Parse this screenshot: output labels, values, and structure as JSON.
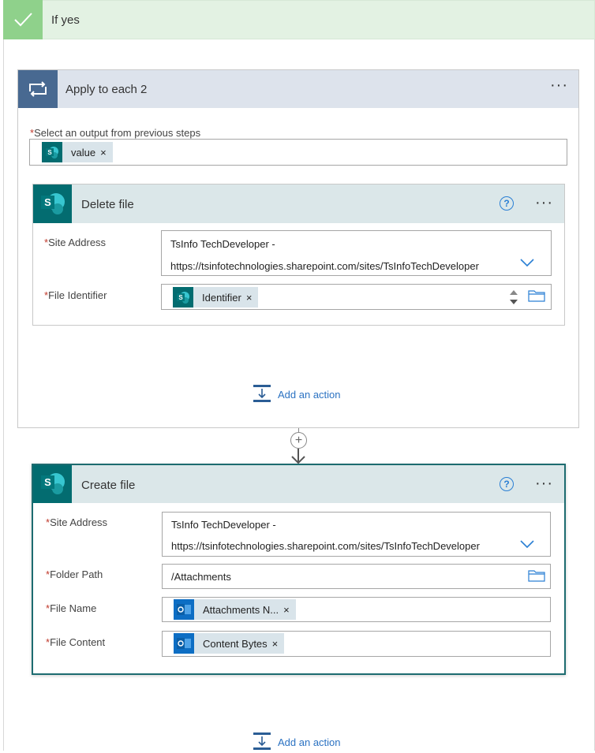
{
  "if_yes": {
    "label": "If yes"
  },
  "apply_each": {
    "title": "Apply to each 2",
    "more": "···",
    "select_label": "Select an output from previous steps",
    "required_mark": "*",
    "token": "value",
    "remove": "×"
  },
  "delete_file": {
    "title": "Delete file",
    "help": "?",
    "more": "···",
    "site_label": "Site Address",
    "site_line1": "TsInfo TechDeveloper -",
    "site_line2": "https://tsinfotechnologies.sharepoint.com/sites/TsInfoTechDeveloper",
    "file_id_label": "File Identifier",
    "file_id_token": "Identifier",
    "remove": "×"
  },
  "add_action": {
    "label": "Add an action"
  },
  "connector": {
    "plus": "+"
  },
  "create_file": {
    "title": "Create file",
    "help": "?",
    "more": "···",
    "site_label": "Site Address",
    "site_line1": "TsInfo TechDeveloper -",
    "site_line2": "https://tsinfotechnologies.sharepoint.com/sites/TsInfoTechDeveloper",
    "folder_label": "Folder Path",
    "folder_value": "/Attachments",
    "file_name_label": "File Name",
    "file_name_token": "Attachments N...",
    "file_content_label": "File Content",
    "file_content_token": "Content Bytes",
    "remove": "×"
  },
  "colors": {
    "success_green": "#8fd18b",
    "loop_blue": "#486991",
    "sharepoint_teal": "#036c70",
    "outlook_blue": "#0d6ec4",
    "link_blue": "#2b72c2"
  },
  "icons": {
    "check": "check-icon",
    "loop": "loop-icon",
    "sharepoint": "sharepoint-icon",
    "outlook": "outlook-icon",
    "help": "help-icon",
    "chevron": "chevron-down-icon",
    "folder": "folder-icon",
    "add_action": "add-action-icon"
  }
}
